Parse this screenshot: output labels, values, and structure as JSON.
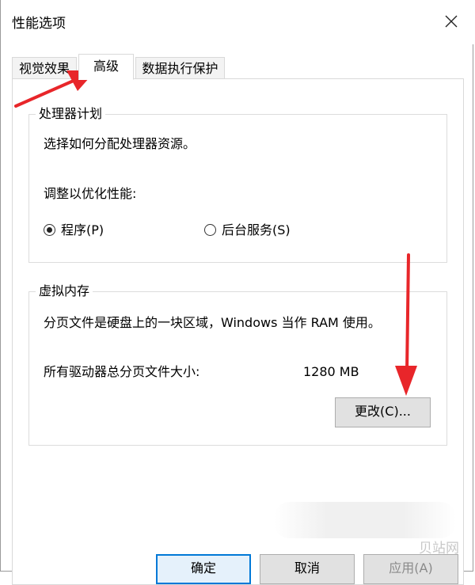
{
  "window": {
    "title": "性能选项"
  },
  "tabs": [
    {
      "label": "视觉效果"
    },
    {
      "label": "高级"
    },
    {
      "label": "数据执行保护"
    }
  ],
  "processor": {
    "legend": "处理器计划",
    "description": "选择如何分配处理器资源。",
    "adjust_label": "调整以优化性能:",
    "options": [
      {
        "label": "程序(P)",
        "checked": true
      },
      {
        "label": "后台服务(S)",
        "checked": false
      }
    ]
  },
  "virtual_memory": {
    "legend": "虚拟内存",
    "description": "分页文件是硬盘上的一块区域，Windows 当作 RAM 使用。",
    "total_label": "所有驱动器总分页文件大小:",
    "total_value": "1280 MB",
    "change_button": "更改(C)..."
  },
  "footer": {
    "ok": "确定",
    "cancel": "取消",
    "apply": "应用(A)"
  },
  "watermark": "贝站网",
  "colors": {
    "annotation_arrow": "#e8262a",
    "focus_border": "#0078d7"
  }
}
